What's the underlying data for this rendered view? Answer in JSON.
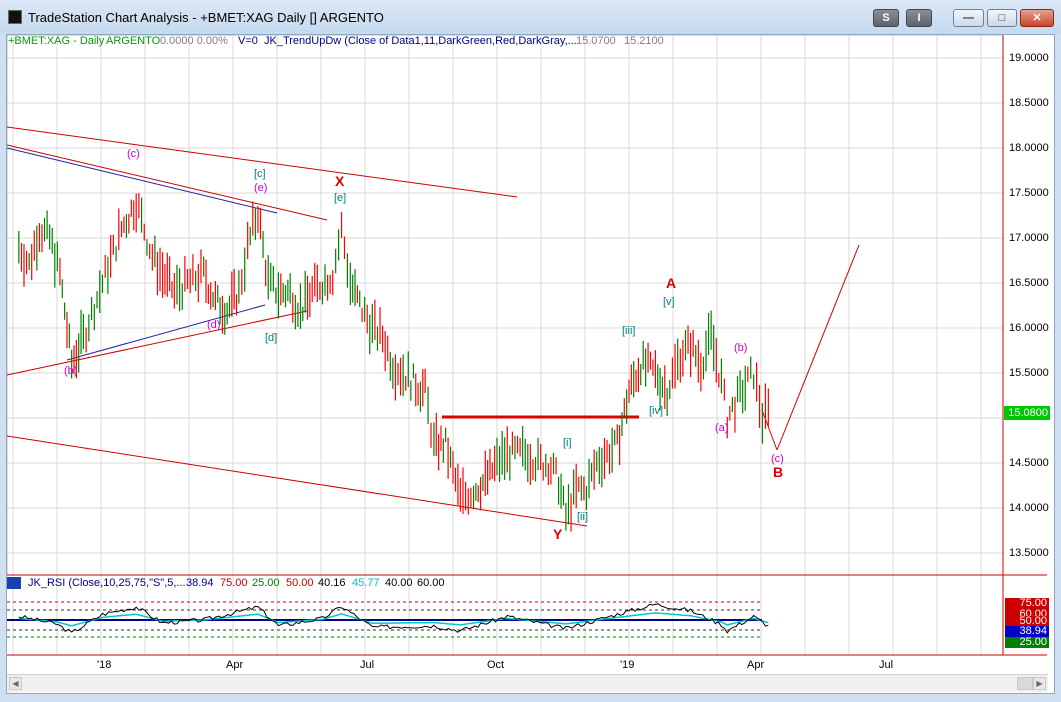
{
  "window": {
    "title": "TradeStation Chart Analysis - +BMET:XAG Daily [] ARGENTO",
    "buttons": {
      "s1": "S",
      "s2": "I",
      "minimize": "—",
      "restore": "□",
      "close": "✕"
    }
  },
  "header": {
    "symbol": "+BMET:XAG - Daily",
    "name": "ARGENTO",
    "values": "0.0000   0.00%",
    "v": "V=0",
    "indicator": "JK_TrendUpDw (Close of Data1,11,DarkGreen,Red,DarkGray,...",
    "v1": "15.0700",
    "v2": "15.2100"
  },
  "rsi_header": {
    "label": "JK_RSI (Close,10,25,75,\"S\",5,...",
    "v1": "38.94",
    "v2": "75.00",
    "v3": "25.00",
    "v4": "50.00",
    "v5": "40.16",
    "v6": "45.77",
    "v7": "40.00",
    "v8": "60.00"
  },
  "price_axis": [
    "19.0000",
    "18.5000",
    "18.0000",
    "17.5000",
    "17.0000",
    "16.5000",
    "16.0000",
    "15.5000",
    "14.5000",
    "14.0000",
    "13.5000"
  ],
  "last_price": "15.0800",
  "rsi_axis": {
    "r75": "75.00",
    "r60": "60.00",
    "r50": "50.00",
    "current": "38.94",
    "r25": "25.00"
  },
  "time_axis": [
    "'18",
    "Apr",
    "Jul",
    "Oct",
    "'19",
    "Apr",
    "Jul"
  ],
  "wave_labels": {
    "c_small": "(c)",
    "b_small": "(b)",
    "c_br": "[c]",
    "e_small": "(e)",
    "X": "X",
    "e_br": "[e]",
    "d_small": "(d)",
    "d_br": "[d]",
    "A": "A",
    "v_br": "[v]",
    "iii_br": "[iii]",
    "iv_br": "[iv]",
    "b2_small": "(b)",
    "a_small": "(a)",
    "c2_small": "(c)",
    "B": "B",
    "i_br": "[i]",
    "ii_br": "[ii]",
    "Y": "Y"
  },
  "colors": {
    "up": "#008000",
    "down": "#ff0000",
    "trend": "#cc0000",
    "teal": "#008080",
    "magenta": "#cc00cc",
    "blue": "#00008b",
    "cyan": "#00c8c8"
  },
  "chart_data": [
    {
      "type": "line",
      "title": "+BMET:XAG - Daily",
      "y_axis_range": [
        13.3,
        19.1
      ],
      "x_axis_range": [
        "2017-11",
        "2019-09"
      ],
      "series": [
        {
          "name": "ARGENTO",
          "points": [
            [
              "2017-11-06",
              16.9
            ],
            [
              "2017-11-13",
              16.7
            ],
            [
              "2017-11-20",
              17.1
            ],
            [
              "2017-11-27",
              17.0
            ],
            [
              "2017-12-04",
              16.6
            ],
            [
              "2017-12-12",
              15.6
            ],
            [
              "2017-12-20",
              15.9
            ],
            [
              "2018-01-02",
              16.5
            ],
            [
              "2018-01-15",
              17.1
            ],
            [
              "2018-01-25",
              17.4
            ],
            [
              "2018-02-05",
              16.8
            ],
            [
              "2018-02-12",
              16.6
            ],
            [
              "2018-02-20",
              16.4
            ],
            [
              "2018-03-01",
              16.5
            ],
            [
              "2018-03-12",
              16.6
            ],
            [
              "2018-03-20",
              16.3
            ],
            [
              "2018-03-28",
              16.2
            ],
            [
              "2018-04-05",
              16.4
            ],
            [
              "2018-04-11",
              16.9
            ],
            [
              "2018-04-18",
              17.3
            ],
            [
              "2018-04-25",
              16.5
            ],
            [
              "2018-05-02",
              16.4
            ],
            [
              "2018-05-10",
              16.4
            ],
            [
              "2018-05-17",
              16.2
            ],
            [
              "2018-05-25",
              16.4
            ],
            [
              "2018-06-01",
              16.5
            ],
            [
              "2018-06-08",
              16.6
            ],
            [
              "2018-06-14",
              17.1
            ],
            [
              "2018-06-20",
              16.5
            ],
            [
              "2018-06-28",
              16.2
            ],
            [
              "2018-07-05",
              16.0
            ],
            [
              "2018-07-12",
              15.9
            ],
            [
              "2018-07-19",
              15.6
            ],
            [
              "2018-07-26",
              15.5
            ],
            [
              "2018-08-02",
              15.4
            ],
            [
              "2018-08-10",
              15.3
            ],
            [
              "2018-08-16",
              14.7
            ],
            [
              "2018-08-24",
              14.7
            ],
            [
              "2018-09-03",
              14.1
            ],
            [
              "2018-09-12",
              14.2
            ],
            [
              "2018-09-20",
              14.3
            ],
            [
              "2018-09-28",
              14.5
            ],
            [
              "2018-10-05",
              14.6
            ],
            [
              "2018-10-12",
              14.6
            ],
            [
              "2018-10-19",
              14.6
            ],
            [
              "2018-10-26",
              14.5
            ],
            [
              "2018-11-02",
              14.5
            ],
            [
              "2018-11-09",
              14.3
            ],
            [
              "2018-11-14",
              13.9
            ],
            [
              "2018-11-21",
              14.2
            ],
            [
              "2018-11-28",
              14.2
            ],
            [
              "2018-12-05",
              14.5
            ],
            [
              "2018-12-12",
              14.6
            ],
            [
              "2018-12-19",
              14.7
            ],
            [
              "2018-12-27",
              15.3
            ],
            [
              "2019-01-04",
              15.6
            ],
            [
              "2019-01-14",
              15.5
            ],
            [
              "2019-01-22",
              15.3
            ],
            [
              "2019-01-31",
              15.7
            ],
            [
              "2019-02-07",
              15.8
            ],
            [
              "2019-02-14",
              15.6
            ],
            [
              "2019-02-21",
              15.9
            ],
            [
              "2019-02-28",
              15.4
            ],
            [
              "2019-03-04",
              15.0
            ],
            [
              "2019-03-11",
              15.2
            ],
            [
              "2019-03-18",
              15.4
            ],
            [
              "2019-03-22",
              15.5
            ],
            [
              "2019-03-28",
              15.0
            ],
            [
              "2019-04-03",
              15.08
            ]
          ]
        }
      ]
    },
    {
      "type": "line",
      "title": "JK_RSI",
      "y_axis_range": [
        20,
        80
      ],
      "series": [
        {
          "name": "RSI",
          "points": [
            [
              "2017-11-06",
              55
            ],
            [
              "2017-12-01",
              45
            ],
            [
              "2017-12-12",
              32
            ],
            [
              "2018-01-02",
              58
            ],
            [
              "2018-01-25",
              68
            ],
            [
              "2018-02-12",
              46
            ],
            [
              "2018-03-12",
              50
            ],
            [
              "2018-04-18",
              68
            ],
            [
              "2018-05-02",
              42
            ],
            [
              "2018-06-01",
              52
            ],
            [
              "2018-06-14",
              69
            ],
            [
              "2018-07-05",
              40
            ],
            [
              "2018-08-16",
              42
            ],
            [
              "2018-09-03",
              35
            ],
            [
              "2018-10-05",
              55
            ],
            [
              "2018-11-14",
              38
            ],
            [
              "2018-12-19",
              58
            ],
            [
              "2019-01-14",
              72
            ],
            [
              "2019-02-07",
              63
            ],
            [
              "2019-02-28",
              44
            ],
            [
              "2019-03-04",
              35
            ],
            [
              "2019-03-22",
              55
            ],
            [
              "2019-04-03",
              38.94
            ]
          ]
        }
      ]
    }
  ]
}
